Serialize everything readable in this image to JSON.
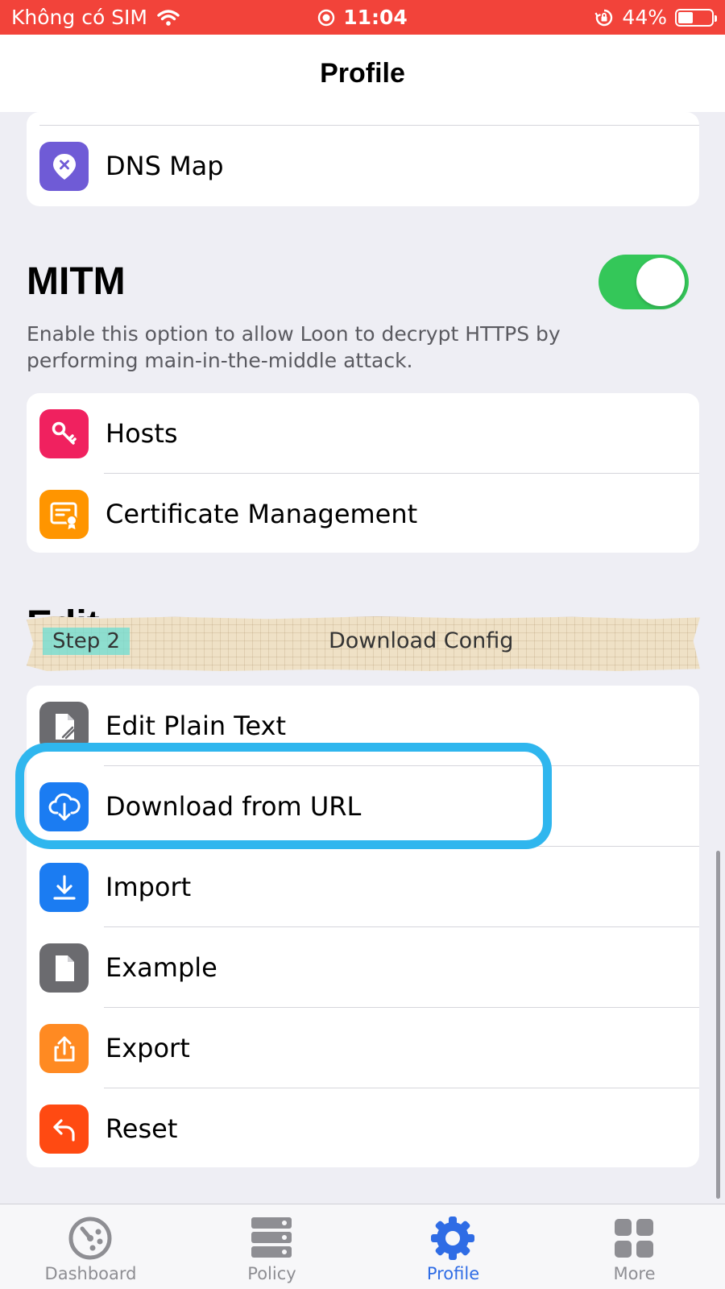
{
  "status_bar": {
    "carrier": "Không có SIM",
    "time": "11:04",
    "battery": "44%",
    "battery_level": 0.44
  },
  "nav": {
    "title": "Profile"
  },
  "top_group": {
    "items": [
      {
        "label": "DNS Map",
        "icon": "map-pin-x-icon",
        "color": "#6f5bd6"
      }
    ]
  },
  "mitm": {
    "title": "MITM",
    "description": "Enable this option to allow Loon to decrypt HTTPS by performing main-in-the-middle attack.",
    "enabled": true,
    "items": [
      {
        "label": "Hosts",
        "icon": "key-icon",
        "color": "#f0215f"
      },
      {
        "label": "Certificate Management",
        "icon": "certificate-icon",
        "color": "#ff9500"
      }
    ]
  },
  "banner": {
    "step": "Step 2",
    "title": "Download Config"
  },
  "edit": {
    "title": "Edit",
    "items": [
      {
        "label": "Edit Plain Text",
        "icon": "document-edit-icon",
        "color": "#6b6b6f"
      },
      {
        "label": "Download from URL",
        "icon": "cloud-download-icon",
        "color": "#1b7cf2"
      },
      {
        "label": "Import",
        "icon": "download-arrow-icon",
        "color": "#1b7cf2"
      },
      {
        "label": "Example",
        "icon": "document-icon",
        "color": "#6b6b6f"
      },
      {
        "label": "Export",
        "icon": "share-icon",
        "color": "#ff8a22"
      },
      {
        "label": "Reset",
        "icon": "undo-icon",
        "color": "#ff4a12"
      }
    ]
  },
  "tabs": [
    {
      "label": "Dashboard",
      "icon": "dashboard-icon",
      "active": false
    },
    {
      "label": "Policy",
      "icon": "server-icon",
      "active": false
    },
    {
      "label": "Profile",
      "icon": "gear-icon",
      "active": true
    },
    {
      "label": "More",
      "icon": "grid-icon",
      "active": false
    }
  ],
  "colors": {
    "status_bar": "#f2433a",
    "toggle_on": "#34c759",
    "tab_active": "#2f6ce5",
    "highlight": "#2fb6ee"
  }
}
